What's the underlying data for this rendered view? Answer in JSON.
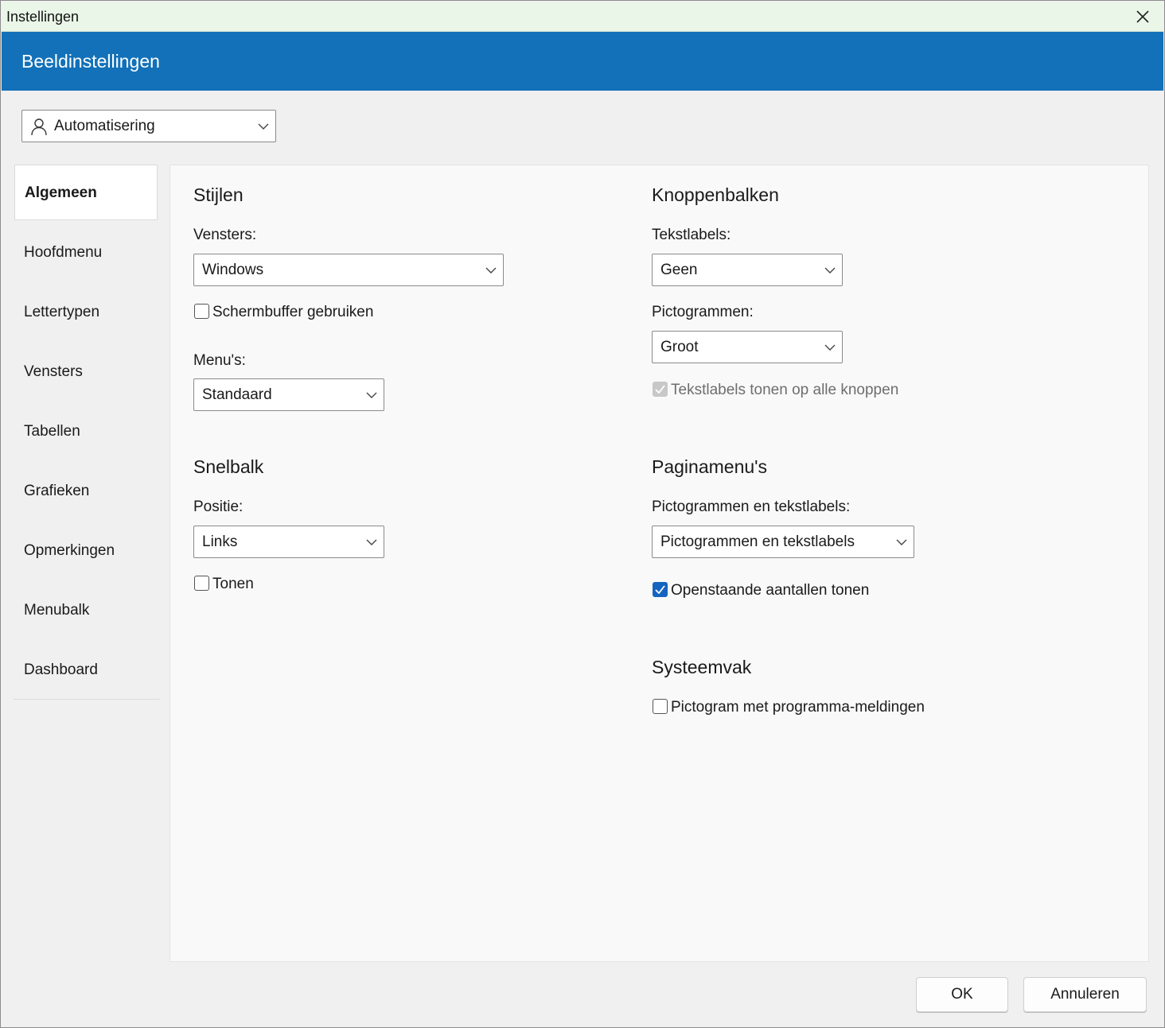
{
  "window": {
    "title": "Instellingen"
  },
  "banner": {
    "title": "Beeldinstellingen"
  },
  "profile": {
    "value": "Automatisering",
    "icon": "user-icon"
  },
  "nav": {
    "items": [
      {
        "label": "Algemeen",
        "active": true
      },
      {
        "label": "Hoofdmenu"
      },
      {
        "label": "Lettertypen"
      },
      {
        "label": "Vensters"
      },
      {
        "label": "Tabellen"
      },
      {
        "label": "Grafieken"
      },
      {
        "label": "Opmerkingen"
      },
      {
        "label": "Menubalk"
      },
      {
        "label": "Dashboard"
      }
    ]
  },
  "stijlen": {
    "heading": "Stijlen",
    "vensters_label": "Vensters:",
    "vensters_value": "Windows",
    "schermbuffer_label": "Schermbuffer gebruiken",
    "schermbuffer_checked": false,
    "menus_label": "Menu's:",
    "menus_value": "Standaard"
  },
  "snelbalk": {
    "heading": "Snelbalk",
    "positie_label": "Positie:",
    "positie_value": "Links",
    "tonen_label": "Tonen",
    "tonen_checked": false
  },
  "knoppenbalken": {
    "heading": "Knoppenbalken",
    "tekstlabels_label": "Tekstlabels:",
    "tekstlabels_value": "Geen",
    "pictogrammen_label": "Pictogrammen:",
    "pictogrammen_value": "Groot",
    "alle_knoppen_label": "Tekstlabels tonen op alle knoppen",
    "alle_knoppen_checked": true,
    "alle_knoppen_disabled": true
  },
  "paginamenus": {
    "heading": "Paginamenu's",
    "pict_label": "Pictogrammen en tekstlabels:",
    "pict_value": "Pictogrammen en tekstlabels",
    "openstaande_label": "Openstaande aantallen tonen",
    "openstaande_checked": true
  },
  "systeemvak": {
    "heading": "Systeemvak",
    "pictogram_label": "Pictogram met programma-meldingen",
    "pictogram_checked": false
  },
  "buttons": {
    "ok": "OK",
    "cancel": "Annuleren"
  },
  "colors": {
    "banner": "#1271b8",
    "accent": "#1565c0",
    "titlebar": "#eaf6e8"
  }
}
